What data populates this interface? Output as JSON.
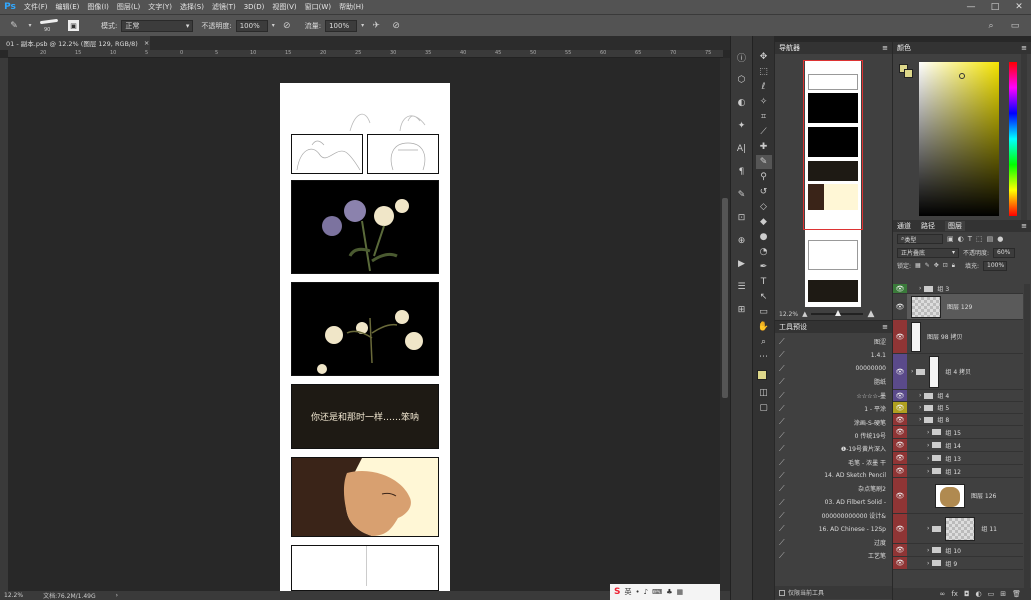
{
  "app": {
    "logo": "Ps"
  },
  "menu": [
    "文件(F)",
    "编辑(E)",
    "图像(I)",
    "图层(L)",
    "文字(Y)",
    "选择(S)",
    "滤镜(T)",
    "3D(D)",
    "视图(V)",
    "窗口(W)",
    "帮助(H)"
  ],
  "window_controls": {
    "minimize": "—",
    "maximize": "□",
    "close": "✕"
  },
  "options": {
    "brush_size": "90",
    "mode_label": "模式:",
    "mode_value": "正常",
    "opacity_label": "不透明度:",
    "opacity_value": "100%",
    "flow_label": "流量:",
    "flow_value": "100%"
  },
  "document_tab": {
    "title": "01 - 副本.psb @ 12.2% (图层 129, RGB/8)",
    "close": "×"
  },
  "ruler_marks": [
    "20",
    "15",
    "10",
    "5",
    "0",
    "5",
    "10",
    "15",
    "20",
    "25",
    "30",
    "35",
    "40",
    "45",
    "50",
    "55",
    "60",
    "65",
    "70",
    "75"
  ],
  "canvas": {
    "caption": "你还是和那时一样……笨呐"
  },
  "status": {
    "zoom": "12.2%",
    "doc_size": "文档:76.2M/1.49G"
  },
  "ime": {
    "label": "英"
  },
  "navigator": {
    "title": "导航器",
    "zoom": "12.2%"
  },
  "presets": {
    "title": "工具预设",
    "items": [
      "图涩",
      "1.4.1",
      "00000000",
      "脂纸",
      "☆☆☆☆-墨",
      "1 - 平涂",
      "涂画-S-硬笔",
      "0 传统19号",
      "❶-19号黄片深入",
      "毛笔 - 浓墨 干",
      "14. AD Sketch Pencil",
      "杂点笔刷2",
      "03. AD Filbert Solid -",
      "000000000000 设计&",
      "16. AD Chinese - 12Sp",
      "过度",
      "工艺笔"
    ],
    "footer_checkbox": "仅限当前工具"
  },
  "color": {
    "title": "颜色"
  },
  "layers": {
    "tabs": [
      "通道",
      "路径",
      "图层"
    ],
    "filter_label": "类型",
    "blend_mode": "正片叠底",
    "opacity_label": "不透明度:",
    "opacity_value": "60%",
    "lock_label": "锁定:",
    "fill_label": "填充:",
    "fill_value": "100%",
    "rows": [
      {
        "name": "组 3",
        "kind": "group"
      },
      {
        "name": "图层 129",
        "kind": "layer"
      },
      {
        "name": "图层 98 拷贝",
        "kind": "layer"
      },
      {
        "name": "组 4 拷贝",
        "kind": "group"
      },
      {
        "name": "组 4",
        "kind": "group"
      },
      {
        "name": "组 5",
        "kind": "group"
      },
      {
        "name": "组 8",
        "kind": "group"
      },
      {
        "name": "组 15",
        "kind": "group"
      },
      {
        "name": "组 14",
        "kind": "group"
      },
      {
        "name": "组 13",
        "kind": "group"
      },
      {
        "name": "组 12",
        "kind": "group"
      },
      {
        "name": "图层 126",
        "kind": "layer"
      },
      {
        "name": "组 11",
        "kind": "group"
      },
      {
        "name": "组 10",
        "kind": "group"
      },
      {
        "name": "组 9",
        "kind": "group"
      }
    ]
  },
  "colors": {
    "accent_red": "#8f3535",
    "accent_purple": "#5a4a8a",
    "accent_yellow": "#b0a020",
    "eye_green": "#3a7a3a",
    "fg_swatch": "#ddd78a"
  }
}
